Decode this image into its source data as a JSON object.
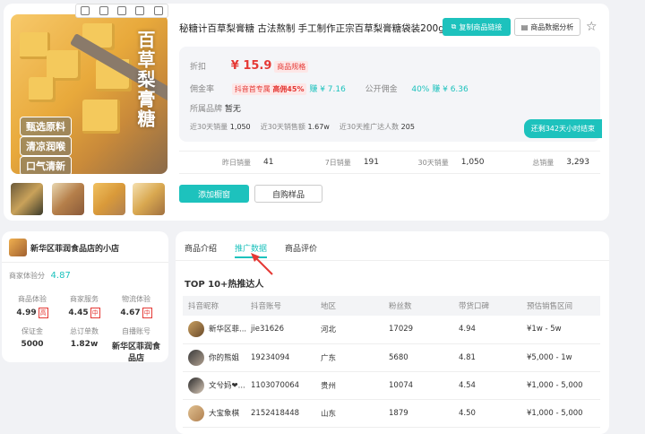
{
  "product": {
    "title": "秘糖计百草梨膏糖 古法熬制 手工制作正宗百草梨膏糖袋装200g",
    "image_brand": "百草梨膏糖",
    "image_tags": [
      "甄选原料",
      "清凉润喉",
      "口气清新"
    ],
    "copy_link_btn": "复制商品链接",
    "analysis_btn": "商品数据分析",
    "discount_label": "折扣",
    "price": "¥ 15.9",
    "price_tag": "商品规格",
    "commission_label": "佣金率",
    "exclusive": "抖音首专属",
    "high_rate": "高佣45%",
    "earn1": "赚 ¥ 7.16",
    "public_label": "公开佣金",
    "public_rate": "40%",
    "earn2": "赚 ¥ 6.36",
    "brand_label": "所属品牌",
    "brand_value": "暂无",
    "sold30_label": "近30天销量",
    "sold30": "1,050",
    "views30_label": "近30天销售额",
    "views30": "1.67w",
    "promoters30_label": "近30天推广达人数",
    "promoters30": "205",
    "countdown": "还剩342天小时结束",
    "add_btn": "添加橱窗",
    "sample_btn": "自购样品"
  },
  "sales": [
    {
      "label": "昨日销量",
      "value": "41"
    },
    {
      "label": "7日销量",
      "value": "191"
    },
    {
      "label": "30天销量",
      "value": "1,050"
    },
    {
      "label": "总销量",
      "value": "3,293"
    }
  ],
  "shop": {
    "name": "新华区菲润食品店的小店",
    "score_label": "商家体验分",
    "score": "4.87",
    "stats": [
      {
        "k": "商品体验",
        "v": "4.99",
        "b": "高"
      },
      {
        "k": "商家服务",
        "v": "4.45",
        "b": "中"
      },
      {
        "k": "物流体验",
        "v": "4.67",
        "b": "中"
      },
      {
        "k": "保证金",
        "v": "5000",
        "b": ""
      },
      {
        "k": "总订单数",
        "v": "1.82w",
        "b": ""
      },
      {
        "k": "自播账号",
        "v": "新华区菲润食品店",
        "b": ""
      }
    ]
  },
  "detail": {
    "tabs": [
      "商品介绍",
      "推广数据",
      "商品评价"
    ],
    "section_title": "TOP 10+热推达人",
    "columns": [
      "抖音昵称",
      "抖音账号",
      "地区",
      "粉丝数",
      "带货口碑",
      "预估销售区间"
    ],
    "rows": [
      [
        "新华区菲...",
        "jie31626",
        "河北",
        "17029",
        "4.94",
        "¥1w - 5w"
      ],
      [
        "你的熊姐",
        "19234094",
        "广东",
        "5680",
        "4.81",
        "¥5,000 - 1w"
      ],
      [
        "文兮妈❤...",
        "1103070064",
        "贵州",
        "10074",
        "4.54",
        "¥1,000 - 5,000"
      ],
      [
        "大宝象棋",
        "2152418448",
        "山东",
        "1879",
        "4.50",
        "¥1,000 - 5,000"
      ]
    ]
  },
  "colors": {
    "accent": "#1dc2bd",
    "price": "#e53935"
  }
}
